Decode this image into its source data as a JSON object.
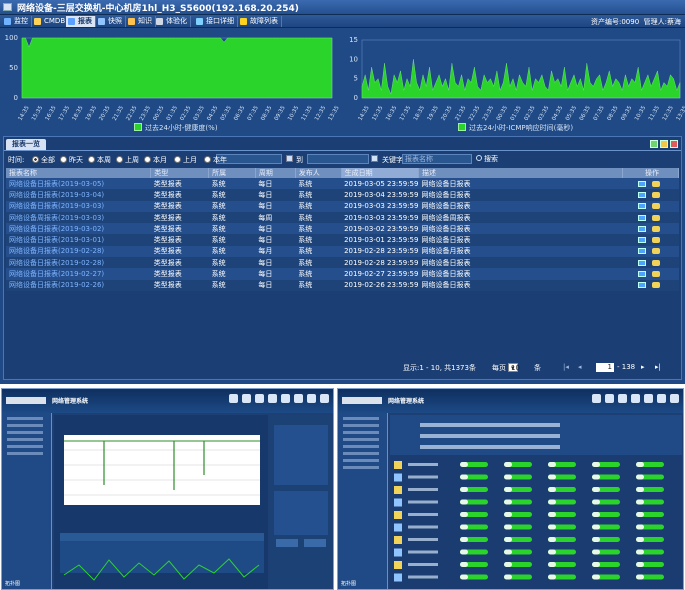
{
  "window": {
    "title": "网络设备-三层交换机-中心机房1hl_H3_S5600(192.168.20.254)"
  },
  "menu": [
    {
      "label": "监控",
      "icon": "monitor-icon",
      "color": "#6fb2ff",
      "active": false
    },
    {
      "label": "CMDB",
      "icon": "database-icon",
      "color": "#ffd257",
      "active": false
    },
    {
      "label": "报表",
      "icon": "report-icon",
      "color": "#5aa0ff",
      "active": true
    },
    {
      "label": "快照",
      "icon": "camera-icon",
      "color": "#8fc4ff",
      "active": false
    },
    {
      "label": "知识",
      "icon": "book-icon",
      "color": "#ffc34d",
      "active": false
    },
    {
      "label": "体验化",
      "icon": "experience-icon",
      "color": "#d0d8e6",
      "active": false
    },
    {
      "label": "接口详细",
      "icon": "interface-icon",
      "color": "#7fd0ff",
      "active": false
    },
    {
      "label": "故障列表",
      "icon": "warning-icon",
      "color": "#ffd21f",
      "active": false
    }
  ],
  "asset": {
    "label": "资产编号:0090",
    "admin": "管理人:蔡海"
  },
  "health_chart": {
    "type": "area",
    "color": "#2bd42b",
    "yticks": [
      "100",
      "50",
      "0"
    ],
    "xticks": [
      "14:35",
      "15:35",
      "16:35",
      "17:35",
      "18:35",
      "19:35",
      "20:35",
      "21:35",
      "22:35",
      "23:35",
      "00:35",
      "01:35",
      "02:35",
      "03:35",
      "04:35",
      "05:35",
      "06:35",
      "07:35",
      "08:35",
      "09:35",
      "10:35",
      "11:35",
      "12:35",
      "13:35"
    ],
    "ylim": [
      0,
      100
    ],
    "values": [
      100,
      100,
      85,
      100,
      100,
      100,
      100,
      100,
      100,
      100,
      100,
      100,
      100,
      100,
      100,
      100,
      100,
      100,
      100,
      100,
      100,
      100,
      100,
      100,
      100,
      100,
      100,
      100,
      100,
      100,
      100,
      100,
      100,
      100,
      100,
      100,
      100,
      100,
      100,
      100,
      100,
      100,
      100,
      100,
      100,
      100,
      100,
      100,
      100,
      100,
      100,
      100,
      100,
      100,
      100,
      100,
      100,
      100,
      93,
      100,
      100,
      100,
      100,
      100,
      100,
      100,
      100,
      100,
      100,
      100,
      100,
      100,
      100,
      100,
      100,
      100,
      100,
      100,
      100,
      100,
      100,
      100,
      100,
      100,
      100,
      100,
      100,
      100,
      100,
      100
    ],
    "legend": "过去24小时-健康度(%)"
  },
  "icmp_chart": {
    "type": "area",
    "color": "#2bd42b",
    "yticks": [
      "15",
      "10",
      "5",
      "0"
    ],
    "xticks": [
      "14:35",
      "15:35",
      "16:35",
      "17:35",
      "18:35",
      "19:35",
      "20:35",
      "21:35",
      "22:35",
      "23:35",
      "00:35",
      "01:35",
      "02:35",
      "03:35",
      "04:35",
      "05:35",
      "06:35",
      "07:35",
      "08:35",
      "09:35",
      "10:35",
      "11:35",
      "12:35",
      "13:35"
    ],
    "ylim": [
      0,
      15
    ],
    "values": [
      3,
      6,
      2,
      8,
      4,
      5,
      2,
      9,
      3,
      1,
      6,
      4,
      7,
      2,
      5,
      3,
      10,
      4,
      2,
      6,
      3,
      8,
      2,
      4,
      6,
      3,
      5,
      2,
      9,
      4,
      3,
      6,
      2,
      5,
      4,
      8,
      3,
      2,
      6,
      4,
      5,
      3,
      7,
      2,
      4,
      9,
      3,
      5,
      2,
      6,
      4,
      3,
      8,
      2,
      5,
      4,
      6,
      3,
      2,
      7,
      4,
      5,
      3,
      8,
      2,
      4,
      6,
      3,
      5,
      2,
      9,
      4,
      3,
      5,
      6,
      2,
      4,
      7,
      3,
      5,
      4,
      2,
      6,
      3,
      5,
      4,
      8,
      2,
      4,
      6,
      3,
      5,
      7,
      2,
      4,
      3,
      6,
      5,
      2,
      4
    ],
    "legend": "过去24小时-ICMP响应时间(毫秒)"
  },
  "report_panel": {
    "tab": "报表一览",
    "filter": {
      "time_label": "时间:",
      "options": [
        "全部",
        "昨天",
        "本周",
        "上周",
        "本月",
        "上月",
        "本年"
      ],
      "selected": "全部",
      "to_label": "到",
      "keyword_label": "关键字",
      "keyword_placeholder": "报表名称",
      "search_label": "搜索"
    },
    "columns": [
      "报表名称",
      "类型",
      "所属",
      "周期",
      "发布人",
      "生成日期",
      "描述",
      "操作"
    ],
    "rows": [
      {
        "name": "网络设备日报表(2019-03-05)",
        "type": "类型报表",
        "owner": "系统",
        "period": "每日",
        "publisher": "系统",
        "date": "2019-03-05 23:59:59",
        "desc": "网络设备日报表"
      },
      {
        "name": "网络设备日报表(2019-03-04)",
        "type": "类型报表",
        "owner": "系统",
        "period": "每日",
        "publisher": "系统",
        "date": "2019-03-04 23:59:59",
        "desc": "网络设备日报表"
      },
      {
        "name": "网络设备日报表(2019-03-03)",
        "type": "类型报表",
        "owner": "系统",
        "period": "每日",
        "publisher": "系统",
        "date": "2019-03-03 23:59:59",
        "desc": "网络设备日报表"
      },
      {
        "name": "网络设备周报表(2019-03-03)",
        "type": "类型报表",
        "owner": "系统",
        "period": "每周",
        "publisher": "系统",
        "date": "2019-03-03 23:59:59",
        "desc": "网络设备周报表"
      },
      {
        "name": "网络设备日报表(2019-03-02)",
        "type": "类型报表",
        "owner": "系统",
        "period": "每日",
        "publisher": "系统",
        "date": "2019-03-02 23:59:59",
        "desc": "网络设备日报表"
      },
      {
        "name": "网络设备日报表(2019-03-01)",
        "type": "类型报表",
        "owner": "系统",
        "period": "每日",
        "publisher": "系统",
        "date": "2019-03-01 23:59:59",
        "desc": "网络设备日报表"
      },
      {
        "name": "网络设备月报表(2019-02-28)",
        "type": "类型报表",
        "owner": "系统",
        "period": "每月",
        "publisher": "系统",
        "date": "2019-02-28 23:59:59",
        "desc": "网络设备月报表"
      },
      {
        "name": "网络设备日报表(2019-02-28)",
        "type": "类型报表",
        "owner": "系统",
        "period": "每日",
        "publisher": "系统",
        "date": "2019-02-28 23:59:59",
        "desc": "网络设备日报表"
      },
      {
        "name": "网络设备日报表(2019-02-27)",
        "type": "类型报表",
        "owner": "系统",
        "period": "每日",
        "publisher": "系统",
        "date": "2019-02-27 23:59:59",
        "desc": "网络设备日报表"
      },
      {
        "name": "网络设备日报表(2019-02-26)",
        "type": "类型报表",
        "owner": "系统",
        "period": "每日",
        "publisher": "系统",
        "date": "2019-02-26 23:59:59",
        "desc": "网络设备日报表"
      }
    ],
    "pager": {
      "summary": "显示:1 - 10, 共1373条",
      "per_page_label": "每页",
      "per_page": "10",
      "unit": "条",
      "page": "1",
      "total": "- 138"
    }
  },
  "thumb_left": {
    "title": "网络管理系统",
    "footer": "拓扑图"
  },
  "thumb_right": {
    "title": "网络管理系统",
    "footer": "拓扑图"
  }
}
